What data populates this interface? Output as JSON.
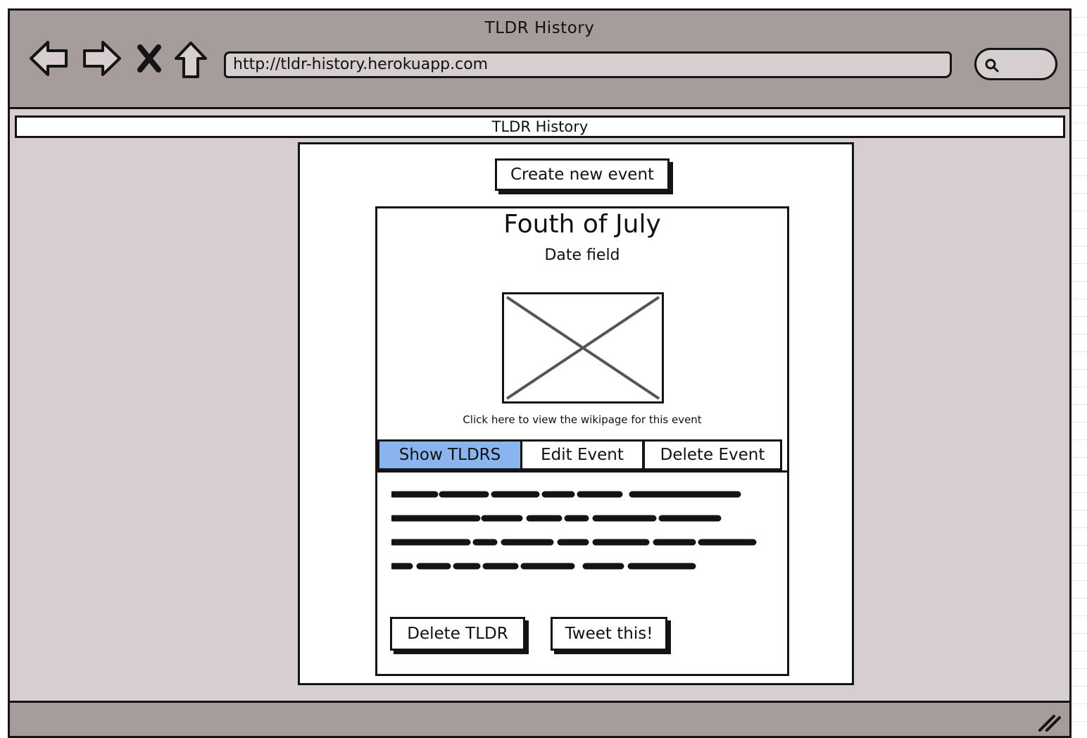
{
  "window": {
    "title": "TLDR History"
  },
  "browser": {
    "url": "http://tldr-history.herokuapp.com",
    "icons": [
      "back-arrow-icon",
      "forward-arrow-icon",
      "close-icon",
      "home-icon",
      "search-icon"
    ]
  },
  "header": {
    "title": "TLDR History"
  },
  "actions": {
    "create_event_label": "Create new event"
  },
  "event": {
    "title": "Fouth of July",
    "date": "Date field",
    "image": "image-placeholder",
    "wiki_link": "Click here to view the wikipage for this event"
  },
  "tabs": [
    {
      "label": "Show TLDRS",
      "active": true
    },
    {
      "label": "Edit Event",
      "active": false
    },
    {
      "label": "Delete Event",
      "active": false
    }
  ],
  "tldr": {
    "delete_label": "Delete TLDR",
    "tweet_label": "Tweet this!"
  },
  "colors": {
    "chrome": "#a69c9c",
    "page": "#d7cfcf",
    "active_tab": "#8ab4ed",
    "ink": "#141414"
  }
}
